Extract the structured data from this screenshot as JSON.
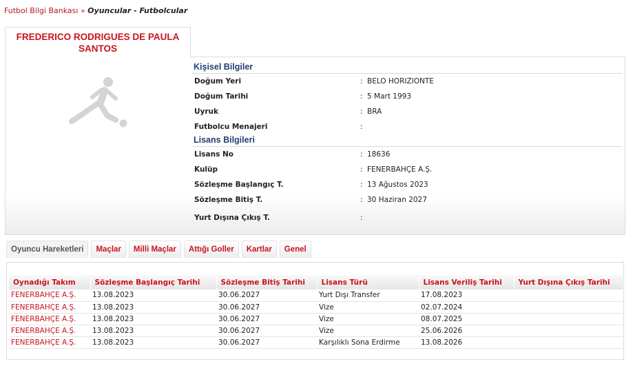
{
  "breadcrumb": {
    "root": "Futbol Bilgi Bankası",
    "separator": "»",
    "current": "Oyuncular - Futbolcular"
  },
  "player": {
    "name_line1": "FREDERICO RODRIGUES DE PAULA",
    "name_line2": "SANTOS",
    "photo_icon": "footballer-silhouette-icon"
  },
  "personal": {
    "title": "Kişisel Bilgiler",
    "rows": [
      {
        "label": "Doğum Yeri",
        "value": "BELO HORIZIONTE"
      },
      {
        "label": "Doğum Tarihi",
        "value": "5 Mart 1993"
      },
      {
        "label": "Uyruk",
        "value": "BRA"
      },
      {
        "label": "Futbolcu Menajeri",
        "value": ""
      }
    ]
  },
  "license": {
    "title": "Lisans Bilgileri",
    "rows": [
      {
        "label": "Lisans No",
        "value": "18636"
      },
      {
        "label": "Kulüp",
        "value": "FENERBAHÇE A.Ş."
      },
      {
        "label": "Sözleşme Başlangıç T.",
        "value": "13 Ağustos 2023"
      },
      {
        "label": "Sözleşme Bitiş T.",
        "value": "30 Haziran 2027"
      },
      {
        "label": "Yurt Dışına Çıkış T.",
        "value": ""
      }
    ]
  },
  "tabs": [
    "Oyuncu Hareketleri",
    "Maçlar",
    "Milli Maçlar",
    "Attığı Goller",
    "Kartlar",
    "Genel"
  ],
  "movements": {
    "headers": [
      "Oynadığı Takım",
      "Sözleşme Başlangıç Tarihi",
      "Sözleşme Bitiş Tarihi",
      "Lisans Türü",
      "Lisans Veriliş Tarihi",
      "Yurt Dışına Çıkış Tarihi"
    ],
    "rows": [
      [
        "FENERBAHÇE A.Ş.",
        "13.08.2023",
        "30.06.2027",
        "Yurt Dışı Transfer",
        "17.08.2023",
        ""
      ],
      [
        "FENERBAHÇE A.Ş.",
        "13.08.2023",
        "30.06.2027",
        "Vize",
        "02.07.2024",
        ""
      ],
      [
        "FENERBAHÇE A.Ş.",
        "13.08.2023",
        "30.06.2027",
        "Vize",
        "08.07.2025",
        ""
      ],
      [
        "FENERBAHÇE A.Ş.",
        "13.08.2023",
        "30.06.2027",
        "Vize",
        "25.06.2026",
        ""
      ],
      [
        "FENERBAHÇE A.Ş.",
        "13.08.2023",
        "30.06.2027",
        "Karşılıklı Sona Erdirme",
        "13.08.2026",
        ""
      ]
    ]
  },
  "colors": {
    "accent_red": "#c8141e",
    "section_blue": "#1f3f73"
  }
}
